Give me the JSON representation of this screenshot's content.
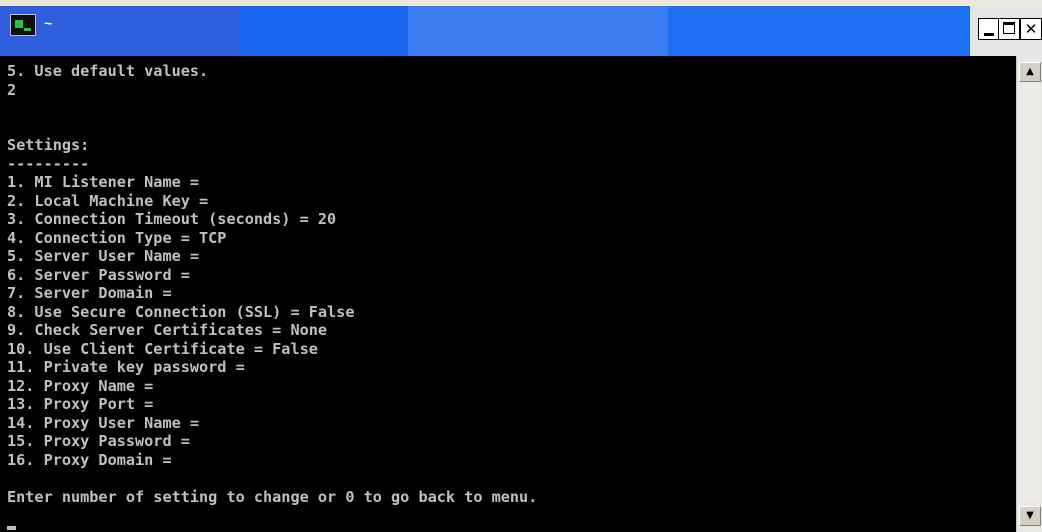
{
  "window": {
    "title": "~",
    "icon": "console-icon",
    "controls": [
      "minimize-icon",
      "maximize-icon",
      "close-icon"
    ]
  },
  "console": {
    "lines": [
      "5. Use default values.",
      "2",
      "",
      "",
      "Settings:",
      "---------",
      "1. MI Listener Name =",
      "2. Local Machine Key =",
      "3. Connection Timeout (seconds) = 20",
      "4. Connection Type = TCP",
      "5. Server User Name =",
      "6. Server Password =",
      "7. Server Domain =",
      "8. Use Secure Connection (SSL) = False",
      "9. Check Server Certificates = None",
      "10. Use Client Certificate = False",
      "11. Private key password =",
      "12. Proxy Name =",
      "13. Proxy Port =",
      "14. Proxy User Name =",
      "15. Proxy Password =",
      "16. Proxy Domain =",
      "",
      "Enter number of setting to change or 0 to go back to menu."
    ]
  },
  "scrollbar": {
    "up": "▲",
    "down": "▼"
  },
  "colors": {
    "console_background": "#000000",
    "console_text": "#c0c0c0",
    "titlebar_blue": "#1a66f0"
  }
}
